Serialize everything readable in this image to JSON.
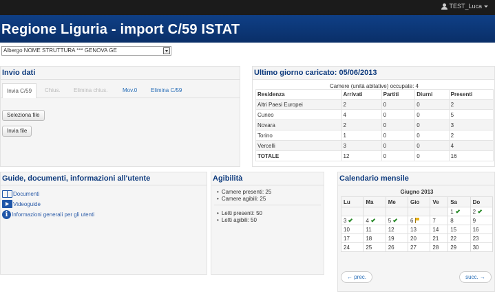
{
  "user": {
    "name": "TEST_Luca"
  },
  "header": {
    "title": "Regione Liguria - import C/59 ISTAT"
  },
  "structure_select": {
    "value": "Albergo NOME STRUTTURA *** GENOVA GE"
  },
  "invio": {
    "title": "Invio dati",
    "tabs": [
      "Invia C/59",
      "Chius.",
      "Elimina chius.",
      "Mov.0",
      "Elimina C/59"
    ],
    "select_file": "Seleziona file",
    "send_file": "Invia file"
  },
  "ultimo": {
    "title": "Ultimo giorno caricato: 05/06/2013",
    "caption": "Camere (unità abitative) occupate: 4",
    "headers": [
      "Residenza",
      "Arrivati",
      "Partiti",
      "Diurni",
      "Presenti"
    ],
    "rows": [
      [
        "Altri Paesi Europei",
        "2",
        "0",
        "0",
        "2"
      ],
      [
        "Cuneo",
        "4",
        "0",
        "0",
        "5"
      ],
      [
        "Novara",
        "2",
        "0",
        "0",
        "3"
      ],
      [
        "Torino",
        "1",
        "0",
        "0",
        "2"
      ],
      [
        "Vercelli",
        "3",
        "0",
        "0",
        "4"
      ]
    ],
    "total": [
      "TOTALE",
      "12",
      "0",
      "0",
      "16"
    ]
  },
  "guide": {
    "title": "Guide, documenti, informazioni all'utente",
    "items": [
      "Documenti",
      "Videoguide",
      "Informazioni generali per gli utenti"
    ]
  },
  "agibilita": {
    "title": "Agibilità",
    "group1": [
      "Camere presenti: 25",
      "Camere agibili: 25"
    ],
    "group2": [
      "Letti presenti: 50",
      "Letti agibili: 50"
    ]
  },
  "calendario": {
    "title": "Calendario mensile",
    "month": "Giugno 2013",
    "weekdays": [
      "Lu",
      "Ma",
      "Me",
      "Gio",
      "Ve",
      "Sa",
      "Do"
    ],
    "weeks": [
      [
        "",
        "",
        "",
        "",
        "",
        "1",
        "2"
      ],
      [
        "3",
        "4",
        "5",
        "6",
        "7",
        "8",
        "9"
      ],
      [
        "10",
        "11",
        "12",
        "13",
        "14",
        "15",
        "16"
      ],
      [
        "17",
        "18",
        "19",
        "20",
        "21",
        "22",
        "23"
      ],
      [
        "24",
        "25",
        "26",
        "27",
        "28",
        "29",
        "30"
      ]
    ],
    "prev": "← prec.",
    "next": "succ. →"
  }
}
